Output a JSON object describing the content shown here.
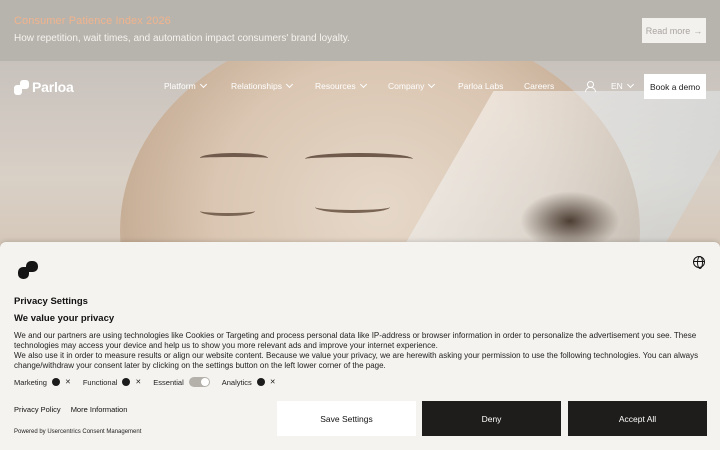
{
  "announcement": {
    "title": "Consumer Patience Index 2026",
    "text": "How repetition, wait times, and automation impact consumers' brand loyalty.",
    "read_more": "Read more",
    "arrow": "→"
  },
  "nav": {
    "logo": "Parloa",
    "items": [
      {
        "label": "Platform",
        "dropdown": true
      },
      {
        "label": "Relationships",
        "dropdown": true
      },
      {
        "label": "Resources",
        "dropdown": true
      },
      {
        "label": "Company",
        "dropdown": true
      },
      {
        "label": "Parloa Labs",
        "dropdown": false
      },
      {
        "label": "Careers",
        "dropdown": false
      }
    ],
    "language": "EN",
    "cta": "Book a demo"
  },
  "consent": {
    "title": "Privacy Settings",
    "subtitle": "We value your privacy",
    "body": "We and our partners are using technologies like Cookies or Targeting and process personal data like IP-address or browser information in order to personalize the advertisement you see. These technologies may access your device and help us to show you more relevant ads and improve your internet experience.",
    "body2": "We also use it in order to measure results or align our website content. Because we value your privacy, we are herewith asking your permission to use the following technologies. You can always change/withdraw your consent later by clicking on the settings button on the left lower corner of the page.",
    "toggles": [
      {
        "label": "Marketing",
        "state": "off"
      },
      {
        "label": "Functional",
        "state": "off"
      },
      {
        "label": "Essential",
        "state": "on"
      },
      {
        "label": "Analytics",
        "state": "off"
      }
    ],
    "links": [
      "Privacy Policy",
      "More Information"
    ],
    "powered_by": "Powered by Usercentrics Consent Management",
    "buttons": {
      "save": "Save Settings",
      "deny": "Deny",
      "accept": "Accept All"
    }
  },
  "colors": {
    "announce_title": "#f0b48d",
    "dark_button": "#1f1d1b",
    "panel_bg": "#f5f3ef"
  },
  "icons": [
    "parloa-logo-icon",
    "chevron-down-icon",
    "user-icon",
    "globe-icon",
    "close-icon",
    "arrow-right-icon"
  ]
}
